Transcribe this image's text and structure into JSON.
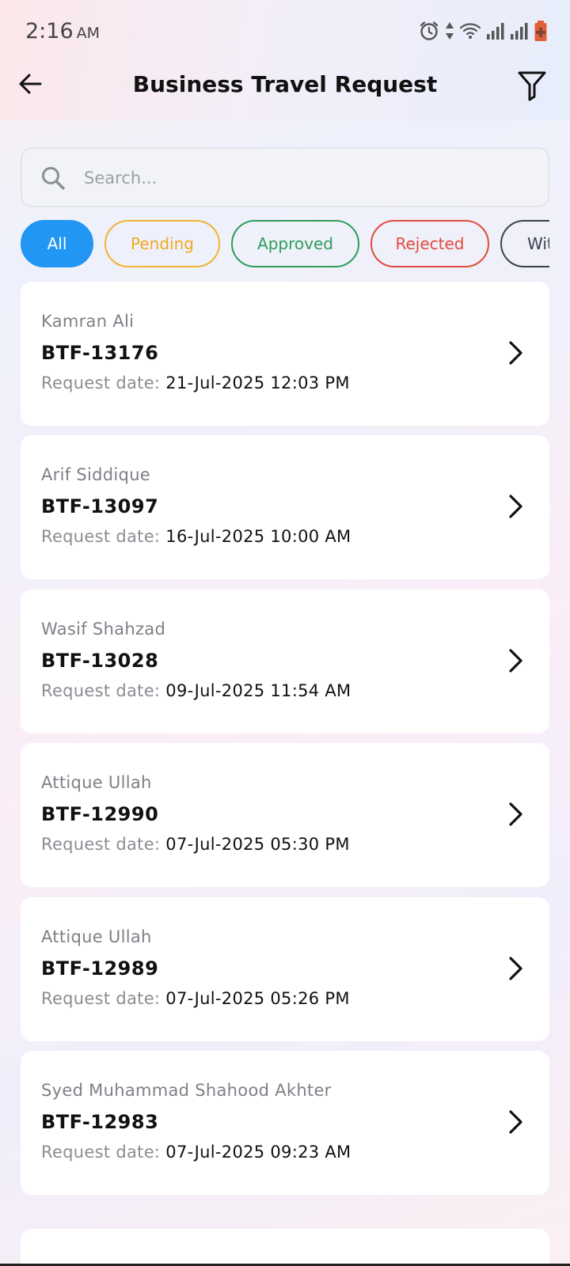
{
  "status_bar": {
    "time": "2:16",
    "ampm": "AM"
  },
  "header": {
    "title": "Business Travel Request"
  },
  "search": {
    "placeholder": "Search..."
  },
  "filters": [
    {
      "label": "All",
      "selected": true
    },
    {
      "label": "Pending"
    },
    {
      "label": "Approved"
    },
    {
      "label": "Rejected"
    },
    {
      "label": "Withdrawn"
    }
  ],
  "requests": [
    {
      "name": "Kamran Ali",
      "code": "BTF-13176",
      "date_label": "Request date:",
      "date": "21-Jul-2025 12:03 PM"
    },
    {
      "name": "Arif Siddique",
      "code": "BTF-13097",
      "date_label": "Request date:",
      "date": "16-Jul-2025 10:00 AM"
    },
    {
      "name": "Wasif Shahzad",
      "code": "BTF-13028",
      "date_label": "Request date:",
      "date": "09-Jul-2025 11:54 AM"
    },
    {
      "name": "Attique Ullah",
      "code": "BTF-12990",
      "date_label": "Request date:",
      "date": "07-Jul-2025 05:30 PM"
    },
    {
      "name": "Attique Ullah",
      "code": "BTF-12989",
      "date_label": "Request date:",
      "date": "07-Jul-2025 05:26 PM"
    },
    {
      "name": "Syed Muhammad Shahood Akhter",
      "code": "BTF-12983",
      "date_label": "Request date:",
      "date": "07-Jul-2025 09:23 AM"
    }
  ],
  "colors": {
    "accent": "#2196f3",
    "pending": "#f2a81e",
    "approved": "#2e9e5a",
    "rejected": "#e24b3b",
    "withdrawn": "#3a3f4a"
  }
}
